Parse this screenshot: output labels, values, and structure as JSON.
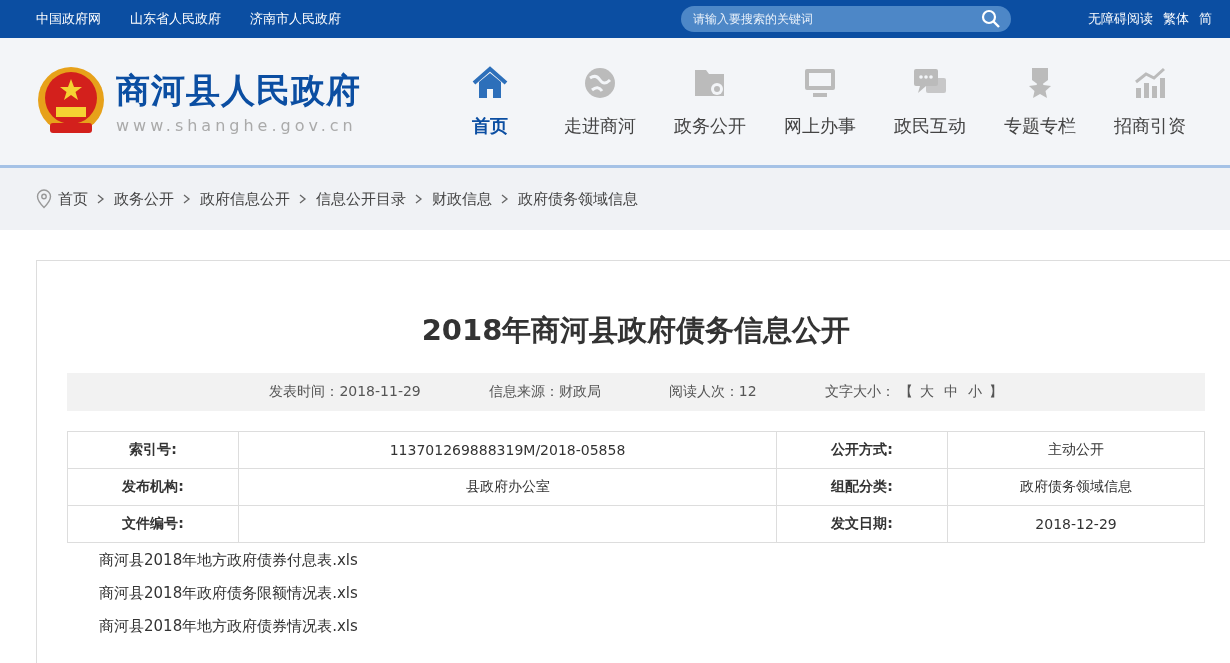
{
  "top_links": [
    "中国政府网",
    "山东省人民政府",
    "济南市人民政府"
  ],
  "search": {
    "placeholder": "请输入要搜索的关键词"
  },
  "top_right": [
    "无障碍阅读",
    "繁体",
    "简"
  ],
  "site": {
    "title": "商河县人民政府",
    "domain": "www.shanghe.gov.cn"
  },
  "nav": [
    {
      "label": "首页",
      "kind": "home",
      "selected": true
    },
    {
      "label": "走进商河",
      "kind": "globe",
      "selected": false
    },
    {
      "label": "政务公开",
      "kind": "folder",
      "selected": false
    },
    {
      "label": "网上办事",
      "kind": "monitor",
      "selected": false
    },
    {
      "label": "政民互动",
      "kind": "chat",
      "selected": false
    },
    {
      "label": "专题专栏",
      "kind": "star",
      "selected": false
    },
    {
      "label": "招商引资",
      "kind": "chart",
      "selected": false
    }
  ],
  "breadcrumb": [
    "首页",
    "政务公开",
    "政府信息公开",
    "信息公开目录",
    "财政信息",
    "政府债务领域信息"
  ],
  "article": {
    "title": "2018年商河县政府债务信息公开",
    "meta": [
      "发表时间：2018-11-29",
      "信息来源：财政局",
      "阅读人次：12"
    ],
    "font_size": {
      "label": "文字大小：",
      "open": "【",
      "options": [
        "大",
        "中",
        "小"
      ],
      "close": "】"
    },
    "info_table": [
      {
        "label": "索引号:",
        "value": "113701269888319M/2018-05858",
        "label_2": "公开方式:",
        "value_2": "主动公开"
      },
      {
        "label": "发布机构:",
        "value": "县政府办公室",
        "label_2": "组配分类:",
        "value_2": "政府债务领域信息"
      },
      {
        "label": "文件编号:",
        "label_2": "发文日期:",
        "value_2": "2018-12-29"
      }
    ],
    "attachments": [
      "商河县2018年地方政府债券付息表.xls",
      "商河县2018年政府债务限额情况表.xls",
      "商河县2018年地方政府债券情况表.xls"
    ]
  }
}
